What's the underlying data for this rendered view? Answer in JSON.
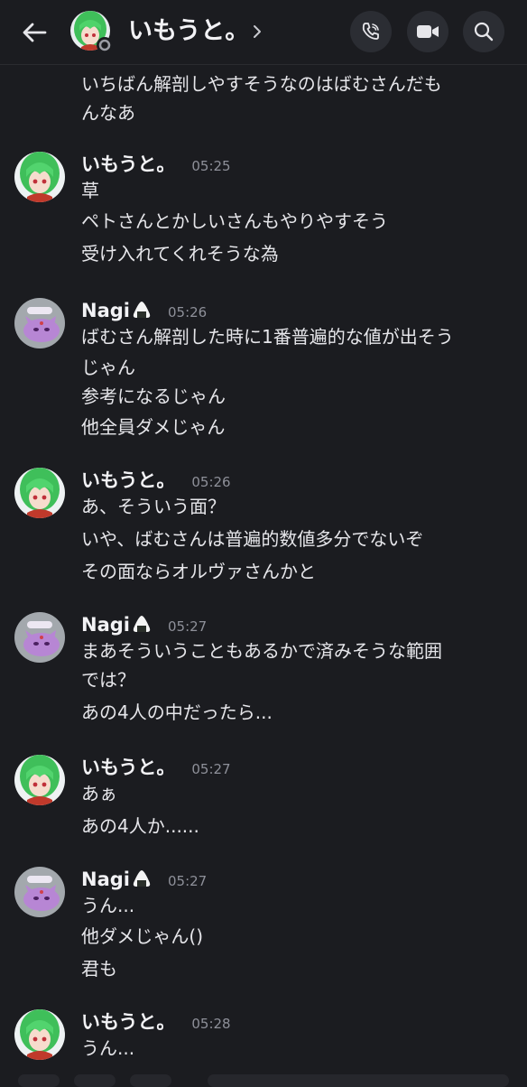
{
  "header": {
    "title": "いもうと。",
    "icons": [
      "back-arrow-icon",
      "phone-call-icon",
      "video-call-icon",
      "search-icon",
      "chevron-right-icon"
    ]
  },
  "messages": {
    "continuation": [
      "いちばん解剖しやすそうなのはばむさんだも",
      "んなあ"
    ],
    "groups": [
      {
        "user": "いもうと。",
        "time": "05:25",
        "avatar": "green-hair-avatar",
        "lines": [
          "草",
          "ペトさんとかしいさんもやりやすそう",
          "受け入れてくれそうな為"
        ]
      },
      {
        "user": "Nagi",
        "time": "05:26",
        "avatar": "purple-cat-avatar",
        "lines": [
          "ばむさん解剖した時に1番普遍的な値が出そう",
          "じゃん",
          "参考になるじゃん",
          "他全員ダメじゃん"
        ]
      },
      {
        "user": "いもうと。",
        "time": "05:26",
        "avatar": "green-hair-avatar",
        "lines": [
          "あ、そういう面？",
          "いや、ばむさんは普遍的数値多分でないぞ",
          "その面ならオルヴァさんかと"
        ]
      },
      {
        "user": "Nagi",
        "time": "05:27",
        "avatar": "purple-cat-avatar",
        "lines": [
          "まあそういうこともあるかで済みそうな範囲",
          "では？",
          "あの4人の中だったら..."
        ]
      },
      {
        "user": "いもうと。",
        "time": "05:27",
        "avatar": "green-hair-avatar",
        "lines": [
          "あぁ",
          "あの4人か......"
        ]
      },
      {
        "user": "Nagi",
        "time": "05:27",
        "avatar": "purple-cat-avatar",
        "lines": [
          "うん...",
          "他ダメじゃん()",
          "君も"
        ]
      },
      {
        "user": "いもうと。",
        "time": "05:28",
        "avatar": "green-hair-avatar",
        "lines": [
          "うん..."
        ]
      }
    ]
  },
  "colors": {
    "background": "#1b1c20",
    "text": "#e6e6ea",
    "timestamp": "#8e9099",
    "button": "#2b2d33"
  }
}
